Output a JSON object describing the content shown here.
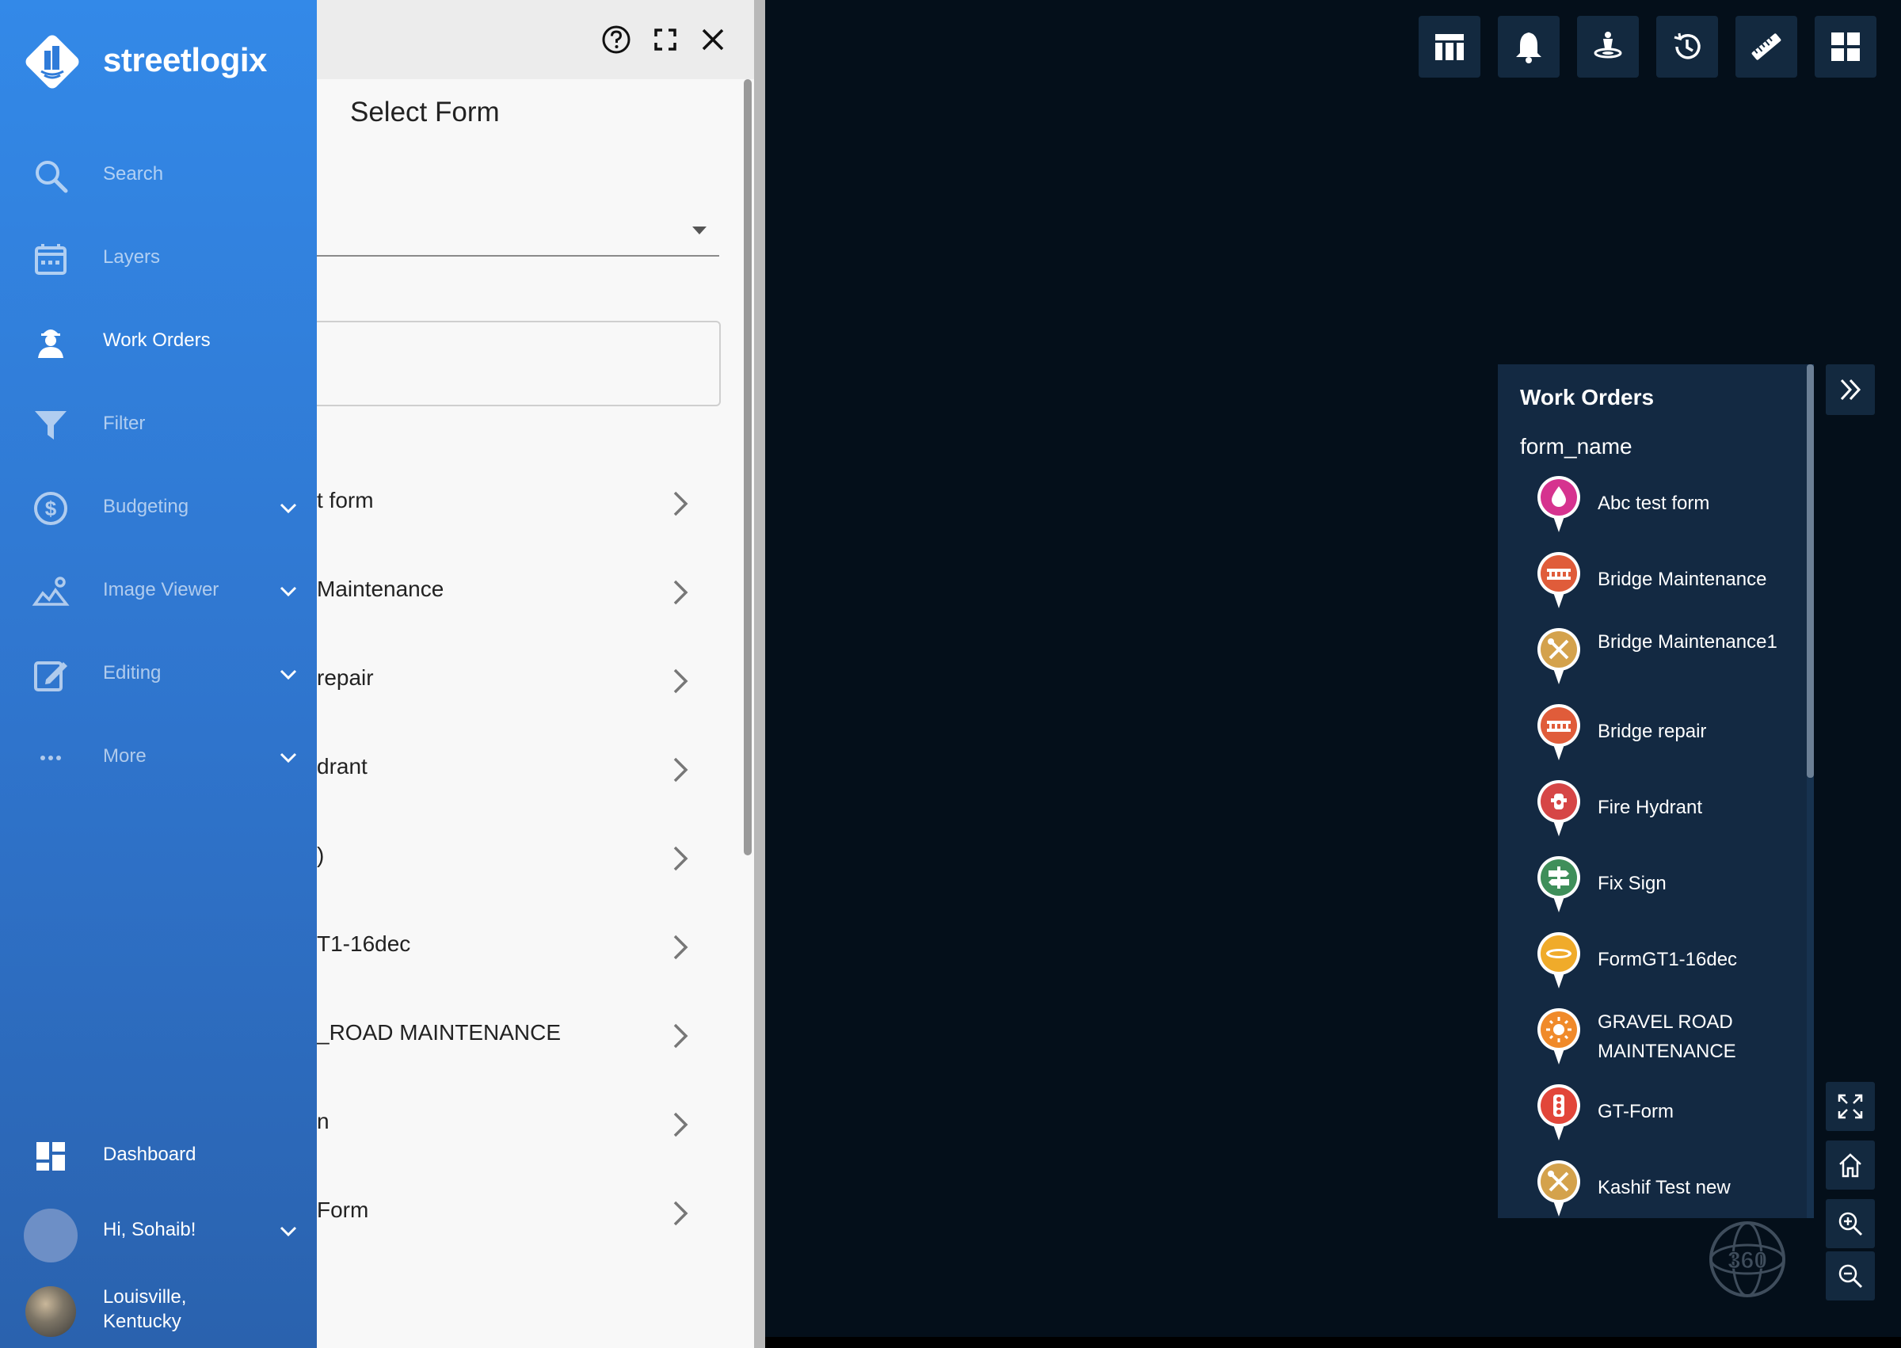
{
  "sidebar": {
    "brand": "streetlogix",
    "nav": [
      {
        "label": "Search",
        "icon": "search-icon"
      },
      {
        "label": "Layers",
        "icon": "layers-icon"
      },
      {
        "label": "Work Orders",
        "icon": "worker-icon"
      },
      {
        "label": "Filter",
        "icon": "filter-icon"
      },
      {
        "label": "Budgeting",
        "icon": "dollar-icon"
      },
      {
        "label": "Image Viewer",
        "icon": "image-viewer-icon"
      },
      {
        "label": "Editing",
        "icon": "edit-icon"
      },
      {
        "label": "More",
        "icon": "more-icon"
      }
    ],
    "dashboard_label": "Dashboard",
    "user_greeting": "Hi, Sohaib!",
    "location": [
      "Louisville,",
      "Kentucky"
    ]
  },
  "form_panel": {
    "title": "Select Form",
    "select_value": "",
    "search_value": "",
    "rows": [
      "t form",
      "Maintenance",
      "repair",
      "drant",
      ")",
      "T1-16dec",
      "_ROAD MAINTENANCE",
      "n",
      "Form"
    ]
  },
  "toolbar": {
    "icons": [
      "table-icon",
      "bell-icon",
      "location-person-icon",
      "history-icon",
      "ruler-icon",
      "grid-icon"
    ]
  },
  "work_orders": {
    "title": "Work Orders",
    "field": "form_name",
    "items": [
      {
        "label": "Abc test form",
        "color": "#d6338f",
        "glyph": "drop"
      },
      {
        "label": "Bridge Maintenance",
        "color": "#e05c3a",
        "glyph": "bridge"
      },
      {
        "label": "Bridge Maintenance1",
        "color": "#d4a24c",
        "glyph": "tools"
      },
      {
        "label": "Bridge repair",
        "color": "#e05c3a",
        "glyph": "bridge"
      },
      {
        "label": "Fire Hydrant",
        "color": "#d64646",
        "glyph": "hydrant"
      },
      {
        "label": "Fix Sign",
        "color": "#3f8f5a",
        "glyph": "sign"
      },
      {
        "label": "FormGT1-16dec",
        "color": "#f0ab2a",
        "glyph": "disc"
      },
      {
        "label": "GRAVEL ROAD MAINTENANCE",
        "color": "#f08a2a",
        "glyph": "sun"
      },
      {
        "label": "GT-Form",
        "color": "#e2463a",
        "glyph": "signal"
      },
      {
        "label": "Kashif Test new",
        "color": "#d4a24c",
        "glyph": "tools"
      }
    ]
  },
  "map_controls": {
    "icons": [
      "expand-icon",
      "home-icon",
      "zoom-in-icon",
      "zoom-out-icon"
    ],
    "label_360": "360"
  }
}
